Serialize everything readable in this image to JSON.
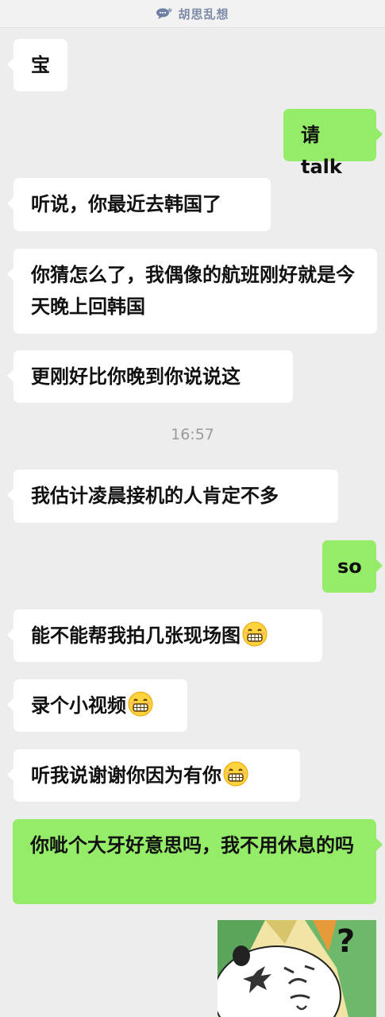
{
  "header": {
    "icon": "speech-bubble-icon",
    "title": "胡思乱想"
  },
  "messages": [
    {
      "id": "m1",
      "side": "left",
      "text": "宝"
    },
    {
      "id": "m2",
      "side": "right",
      "text": "请 talk"
    },
    {
      "id": "m3",
      "side": "left",
      "text": "听说，你最近去韩国了"
    },
    {
      "id": "m4",
      "side": "left",
      "text": "你猜怎么了，我偶像的航班刚好就是今天晚上回韩国"
    },
    {
      "id": "m5",
      "side": "left",
      "text": "更刚好比你晚到你说说这"
    },
    {
      "id": "m6",
      "side": "left",
      "text": "我估计凌晨接机的人肯定不多"
    },
    {
      "id": "m7",
      "side": "right",
      "text": "so"
    },
    {
      "id": "m8",
      "side": "left",
      "text": "能不能帮我拍几张现场图",
      "emoji": "grin-emoji"
    },
    {
      "id": "m9",
      "side": "left",
      "text": "录个小视频",
      "emoji": "grin-emoji"
    },
    {
      "id": "m10",
      "side": "left",
      "text": "听我说谢谢你因为有你",
      "emoji": "grin-emoji"
    },
    {
      "id": "m11",
      "side": "right",
      "text": "你呲个大牙好意思吗，我不用休息的吗"
    }
  ],
  "timestamp": "16:57",
  "sticker": {
    "type": "meme-sticker",
    "mark": "?"
  },
  "colors": {
    "background": "#ededed",
    "left_bubble": "#ffffff",
    "right_bubble": "#95ec69",
    "header_text": "#7e8ba8"
  }
}
